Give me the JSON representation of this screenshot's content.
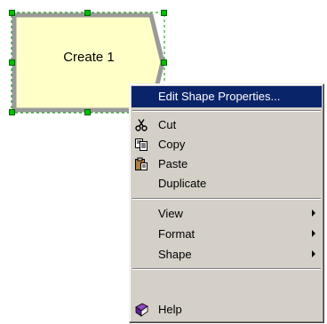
{
  "shape": {
    "label": "Create 1",
    "fill": "#ffffc8",
    "border": "#8a8a8a"
  },
  "menu": {
    "items": [
      {
        "label": "Edit Shape Properties...",
        "icon": "",
        "selected": true,
        "submenu": false
      },
      {
        "label": "Cut",
        "icon": "scissors-icon",
        "submenu": false
      },
      {
        "label": "Copy",
        "icon": "copy-icon",
        "submenu": false
      },
      {
        "label": "Paste",
        "icon": "paste-icon",
        "submenu": false
      },
      {
        "label": "Duplicate",
        "icon": "",
        "submenu": false
      },
      {
        "label": "View",
        "icon": "",
        "submenu": true
      },
      {
        "label": "Format",
        "icon": "",
        "submenu": true
      },
      {
        "label": "Shape",
        "icon": "",
        "submenu": true
      },
      {
        "label": "Help",
        "icon": "help-book-icon",
        "submenu": false
      }
    ],
    "highlight_color": "#0a246a",
    "background_color": "#d4d0c8"
  }
}
